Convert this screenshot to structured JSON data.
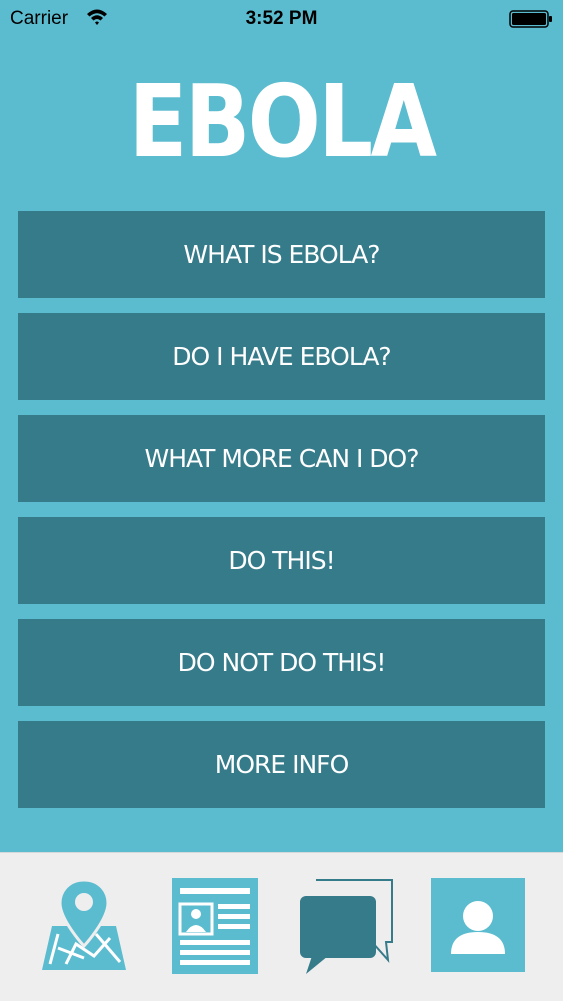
{
  "status_bar": {
    "carrier": "Carrier",
    "time": "3:52 PM",
    "wifi_icon": "wifi-icon",
    "battery_icon": "battery-icon"
  },
  "header": {
    "title": "EBOLA"
  },
  "menu": {
    "items": [
      {
        "label": "WHAT IS EBOLA?"
      },
      {
        "label": "DO I HAVE EBOLA?"
      },
      {
        "label": "WHAT MORE CAN I DO?"
      },
      {
        "label": "DO THIS!"
      },
      {
        "label": "DO NOT DO THIS!"
      },
      {
        "label": "MORE INFO"
      }
    ]
  },
  "tab_bar": {
    "tabs": [
      {
        "icon": "map-pin-icon"
      },
      {
        "icon": "news-icon"
      },
      {
        "icon": "chat-icon"
      },
      {
        "icon": "profile-icon"
      }
    ]
  },
  "colors": {
    "background": "#5bbccf",
    "button": "#357b8a",
    "text": "#ffffff",
    "tab_bar": "#eeeeef"
  }
}
